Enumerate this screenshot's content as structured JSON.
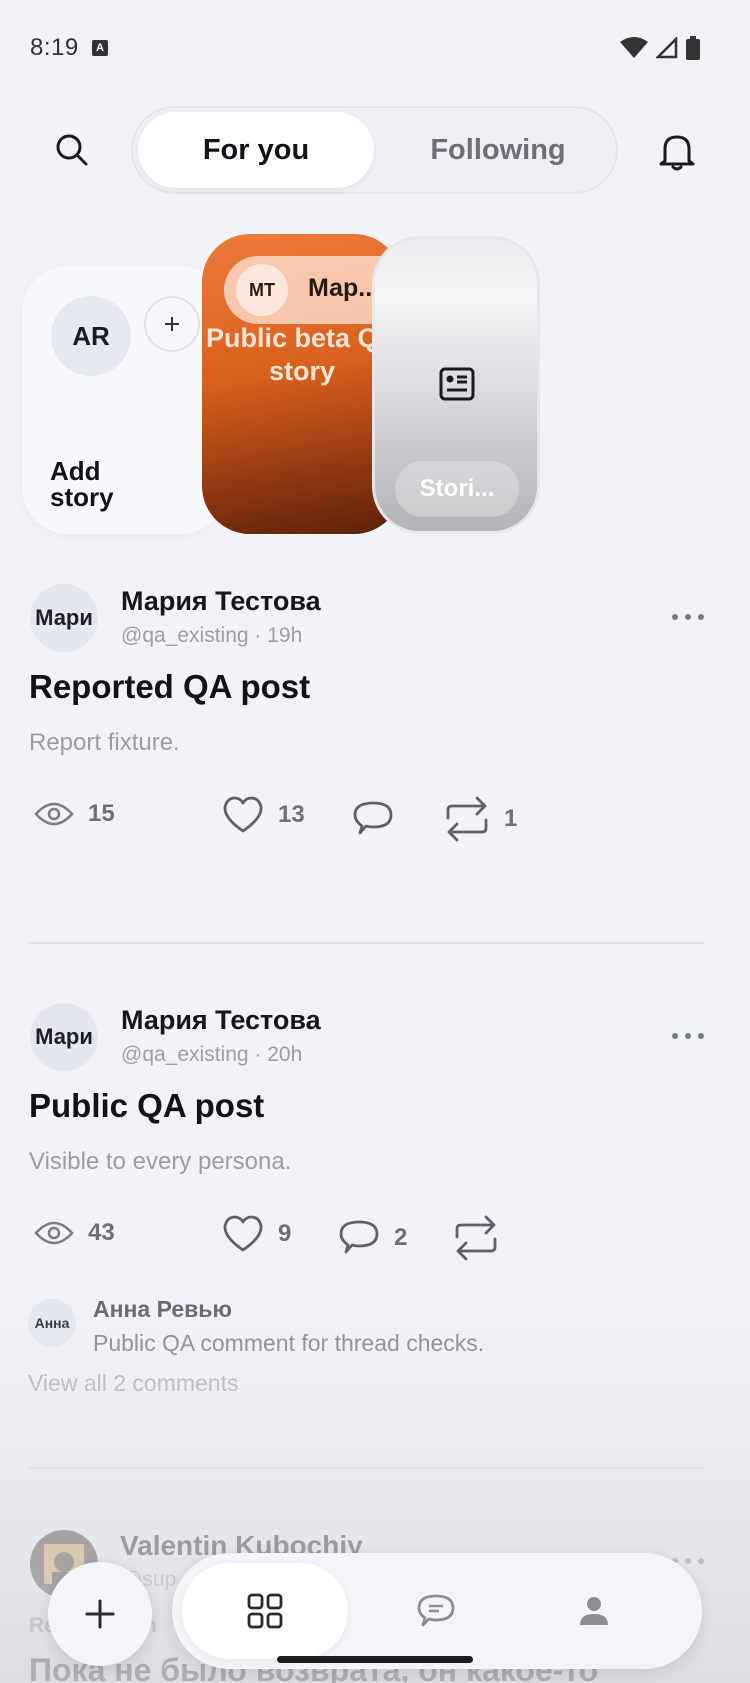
{
  "status_bar": {
    "time": "8:19",
    "a_badge": "A"
  },
  "header": {
    "tabs": [
      {
        "label": "For you",
        "active": true
      },
      {
        "label": "Following",
        "active": false
      }
    ]
  },
  "stories": {
    "add": {
      "avatar_initials": "AR",
      "label": "Add story"
    },
    "items": [
      {
        "avatar_initials": "MT",
        "name": "Мар...",
        "caption": "Public beta QA story"
      },
      {
        "label": "Stori..."
      }
    ]
  },
  "posts": [
    {
      "avatar_text": "Мари",
      "author": "Мария Тестова",
      "handle": "@qa_existing · 19h",
      "title": "Reported QA post",
      "body": "Report fixture.",
      "views": "15",
      "likes": "13",
      "comments": "",
      "reposts": "1"
    },
    {
      "avatar_text": "Мари",
      "author": "Мария Тестова",
      "handle": "@qa_existing · 20h",
      "title": "Public QA post",
      "body": "Visible to every persona.",
      "views": "43",
      "likes": "9",
      "comments": "2",
      "reposts": "",
      "comment_preview": {
        "avatar_text": "Анна",
        "author": "Анна Ревью",
        "text": "Public QA comment for thread checks."
      },
      "view_all": "View all 2 comments"
    },
    {
      "author": "Valentin Kubochiy",
      "handle": "@sup",
      "label_fragment": "Re",
      "label_fragment_2": "n",
      "title": "Пока не было возврата, он какое-то"
    }
  ],
  "colors": {
    "accent_orange": "#d9611d",
    "background": "#f2f3f8"
  }
}
